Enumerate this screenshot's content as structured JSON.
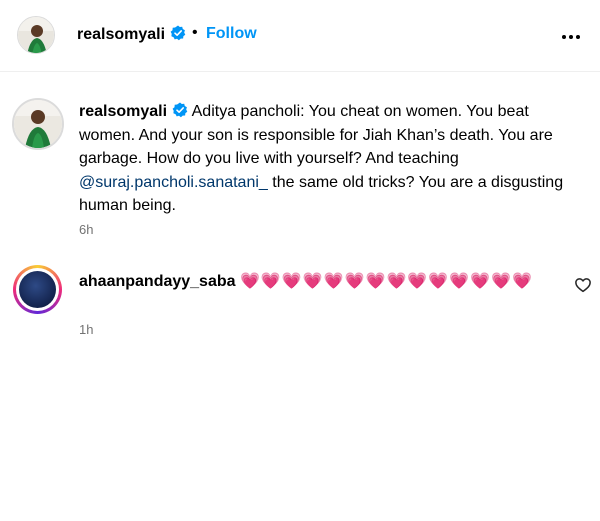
{
  "header": {
    "username": "realsomyali",
    "separator": "•",
    "follow_label": "Follow",
    "more_icon": "more-horizontal-icon"
  },
  "caption": {
    "username": "realsomyali",
    "text_before_mention": "Aditya pancholi: You cheat on women. You beat women. And your son is responsible for Jiah Khan’s death. You are garbage. How do you live with yourself? And teaching ",
    "mention": "@suraj.pancholi.sanatani_",
    "text_after_mention": " the same old tricks? You are a disgusting human being.",
    "time": "6h"
  },
  "comment": {
    "username": "ahaanpandayy_saba",
    "hearts": "💗💗💗💗💗💗💗💗💗💗💗💗💗💗",
    "time": "1h",
    "like_icon": "heart-outline-icon"
  },
  "colors": {
    "link_blue": "#0095f6",
    "mention": "#00376b",
    "secondary_text": "#737373",
    "heart": "#e0245e"
  }
}
